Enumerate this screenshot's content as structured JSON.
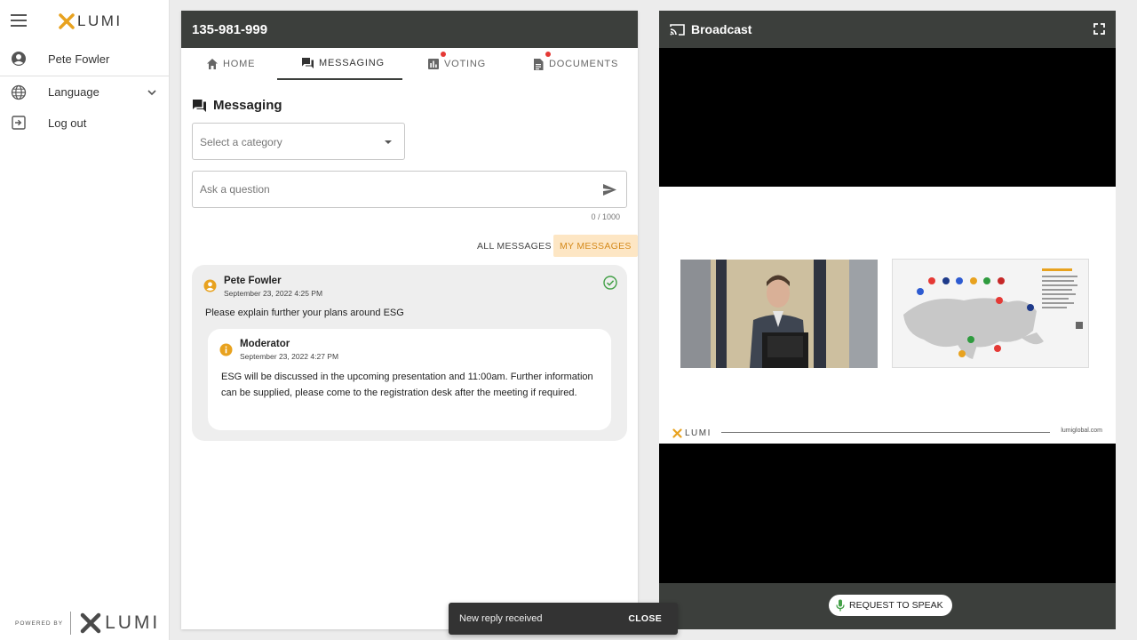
{
  "sidebar": {
    "logo_text": "LUMI",
    "user_name": "Pete Fowler",
    "language_label": "Language",
    "logout_label": "Log out",
    "powered_by": "POWERED BY",
    "powered_logo_text": "LUMI"
  },
  "meeting": {
    "id": "135-981-999"
  },
  "tabs": [
    {
      "label": "HOME",
      "active": false,
      "badge": false
    },
    {
      "label": "MESSAGING",
      "active": true,
      "badge": false
    },
    {
      "label": "VOTING",
      "active": false,
      "badge": true
    },
    {
      "label": "DOCUMENTS",
      "active": false,
      "badge": true
    }
  ],
  "messaging": {
    "title": "Messaging",
    "category_placeholder": "Select a category",
    "ask_placeholder": "Ask a question",
    "counter": "0 / 1000",
    "filter_all": "ALL MESSAGES",
    "filter_mine": "MY MESSAGES"
  },
  "message": {
    "author": "Pete Fowler",
    "date": "September 23, 2022 4:25 PM",
    "text": "Please explain further your plans around ESG",
    "status_icon": "check-circle-icon",
    "reply": {
      "author": "Moderator",
      "date": "September 23, 2022 4:27 PM",
      "text": "ESG will be discussed in the upcoming presentation and 11:00am. Further information can be supplied, please come to the registration desk after the meeting if required."
    }
  },
  "broadcast": {
    "title": "Broadcast",
    "request_to_speak": "REQUEST TO SPEAK",
    "slide_logo_text": "LUMI",
    "slide_url": "lumiglobal.com"
  },
  "snackbar": {
    "text": "New reply received",
    "close_label": "CLOSE"
  },
  "colors": {
    "header": "#3c3f3c",
    "accent_orange": "#e8a21f",
    "success_green": "#43a047",
    "badge_red": "#e53935"
  }
}
